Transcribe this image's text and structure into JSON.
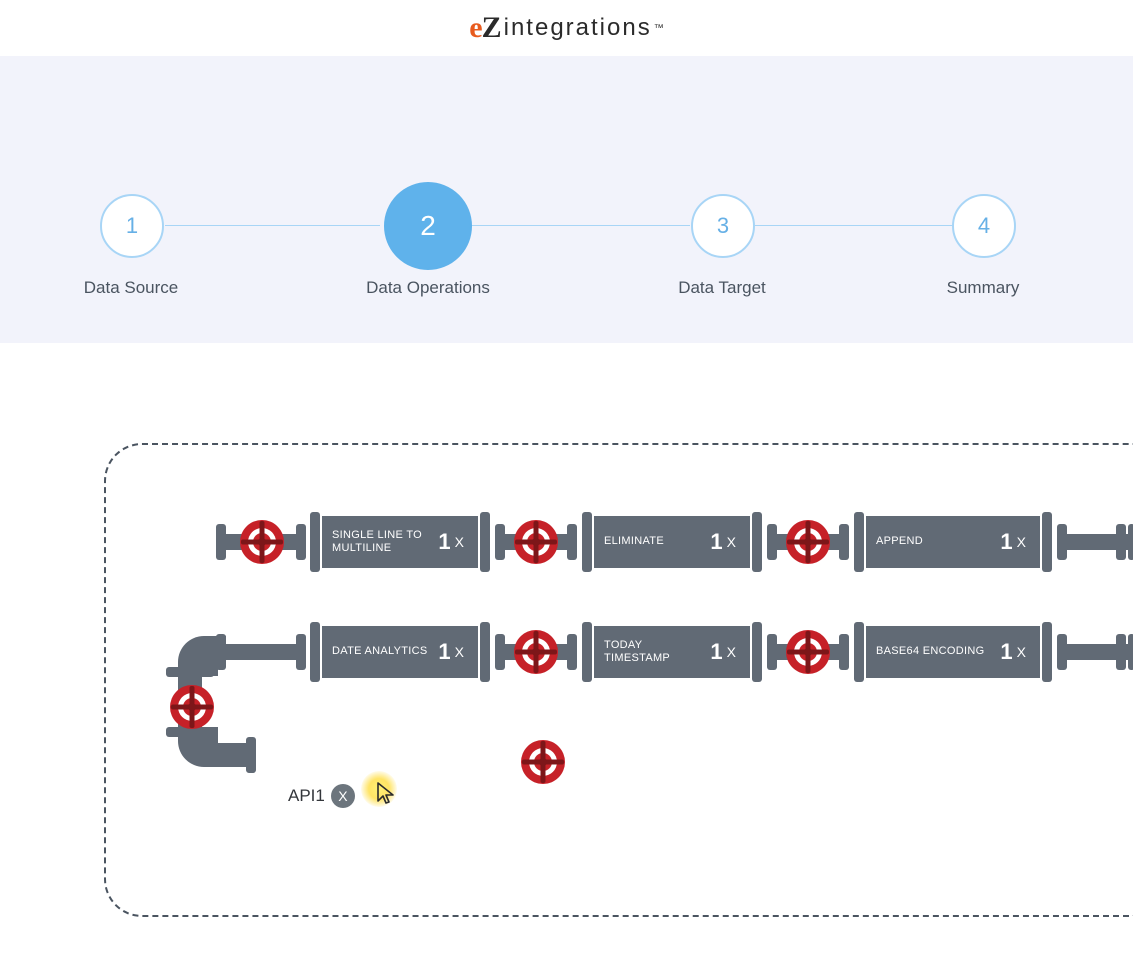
{
  "logo": {
    "e": "e",
    "z": "Z",
    "rest": "integrations",
    "tm": "™"
  },
  "stepper": {
    "steps": [
      {
        "num": "1",
        "label": "Data Source"
      },
      {
        "num": "2",
        "label": "Data Operations"
      },
      {
        "num": "3",
        "label": "Data Target"
      },
      {
        "num": "4",
        "label": "Summary"
      }
    ],
    "active_index": 1
  },
  "pipeline": {
    "row1": [
      {
        "label": "SINGLE LINE TO MULTILINE",
        "count": "1",
        "x": "X"
      },
      {
        "label": "ELIMINATE",
        "count": "1",
        "x": "X"
      },
      {
        "label": "APPEND",
        "count": "1",
        "x": "X"
      }
    ],
    "row2": [
      {
        "label": "DATE ANALYTICS",
        "count": "1",
        "x": "X"
      },
      {
        "label": "TODAY TIMESTAMP",
        "count": "1",
        "x": "X"
      },
      {
        "label": "BASE64 ENCODING",
        "count": "1",
        "x": "X"
      }
    ]
  },
  "api_item": {
    "label": "API1",
    "x": "X"
  },
  "colors": {
    "accent_blue": "#5fb2eb",
    "accent_blue_light": "#a8d5f6",
    "pipe_gray": "#616a75",
    "valve_red": "#c62128",
    "valve_dark": "#7d1619",
    "bg_lavender": "#f2f3fb"
  }
}
